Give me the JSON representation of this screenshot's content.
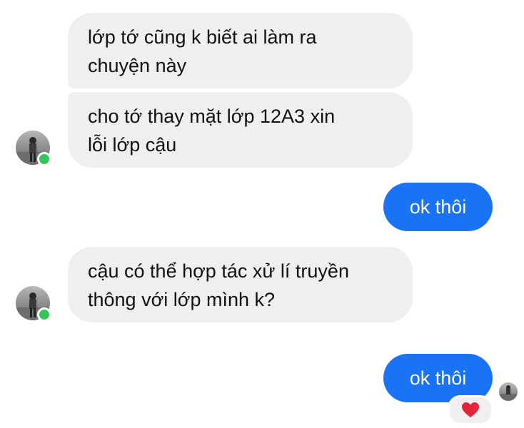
{
  "messages": [
    {
      "line1": "lớp tớ cũng k biết ai làm ra",
      "line2": "chuyện này"
    },
    {
      "line1": "cho tớ thay mặt lớp 12A3 xin",
      "line2": "lỗi lớp cậu"
    },
    {
      "text": "ok thôi"
    },
    {
      "line1": "cậu có thể hợp tác xử lí truyền",
      "line2": "thông với lớp mình k?"
    },
    {
      "text": "ok thôi"
    }
  ],
  "reaction": {
    "icon": "heart-icon",
    "color": "#e3243b"
  },
  "colors": {
    "outgoing": "#1a73f5",
    "incoming": "#efefef",
    "online": "#35c65a"
  }
}
